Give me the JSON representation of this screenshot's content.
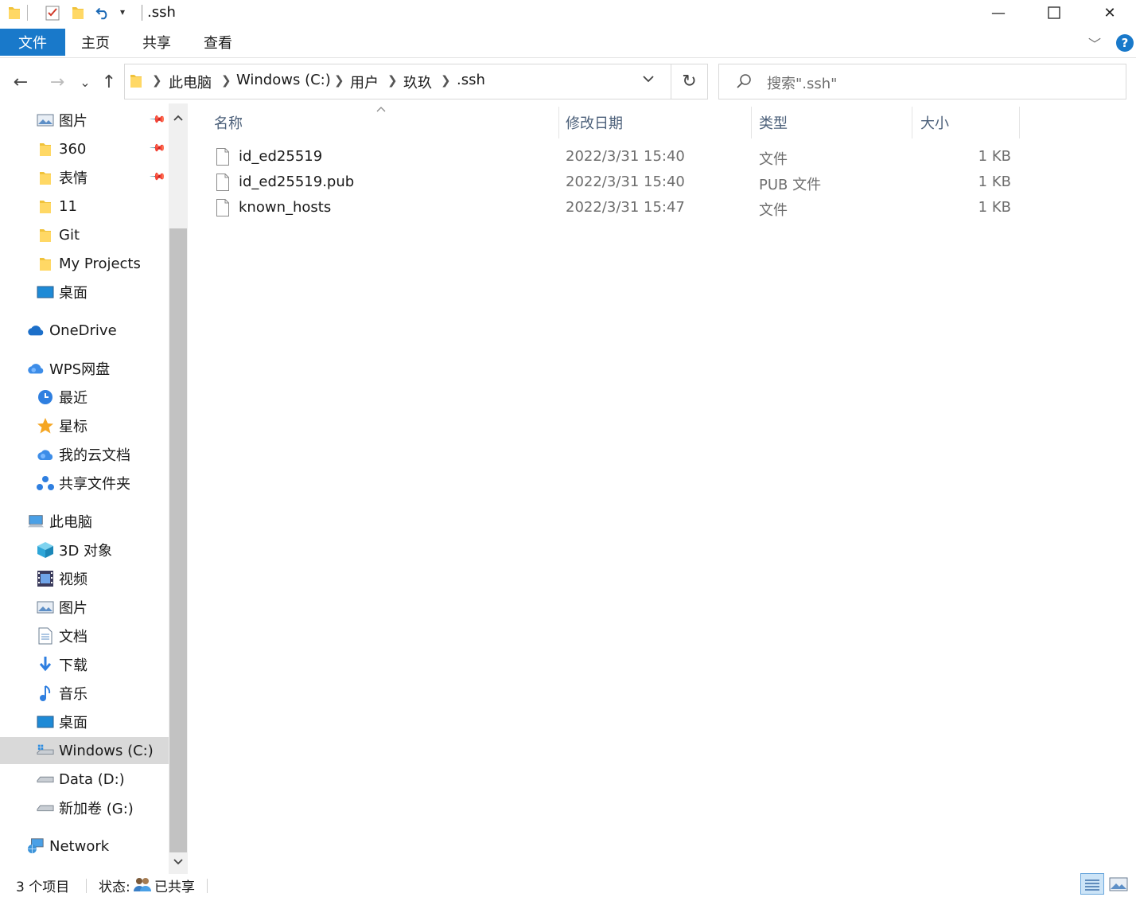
{
  "window": {
    "title": ".ssh",
    "minimize_label": "—",
    "maximize_label": "☐",
    "close_label": "✕"
  },
  "ribbon": {
    "file_tab": "文件",
    "tabs": [
      "主页",
      "共享",
      "查看"
    ],
    "expand_label": "﹀",
    "help_label": "?"
  },
  "nav": {
    "back_label": "←",
    "forward_label": "→",
    "recent_label": "⌄",
    "up_label": "↑",
    "breadcrumb": [
      "此电脑",
      "Windows (C:)",
      "用户",
      "玖玖",
      ".ssh"
    ],
    "refresh_label": "↻",
    "search_placeholder": "搜索\".ssh\""
  },
  "sidebar": {
    "quick_access": [
      {
        "label": "图片",
        "icon": "pictures-icon",
        "pinned": true
      },
      {
        "label": "360",
        "icon": "folder-icon",
        "pinned": true
      },
      {
        "label": "表情",
        "icon": "folder-icon",
        "pinned": true
      },
      {
        "label": "11",
        "icon": "folder-icon",
        "pinned": false
      },
      {
        "label": "Git",
        "icon": "folder-icon",
        "pinned": false
      },
      {
        "label": "My Projects",
        "icon": "folder-icon",
        "pinned": false
      },
      {
        "label": "桌面",
        "icon": "desktop-icon",
        "pinned": false
      }
    ],
    "onedrive": "OneDrive",
    "wps": "WPS网盘",
    "wps_items": [
      {
        "label": "最近",
        "icon": "clock-icon"
      },
      {
        "label": "星标",
        "icon": "star-icon"
      },
      {
        "label": "我的云文档",
        "icon": "cloud-icon"
      },
      {
        "label": "共享文件夹",
        "icon": "share-icon"
      }
    ],
    "this_pc": "此电脑",
    "pc_items": [
      {
        "label": "3D 对象",
        "icon": "cube-icon"
      },
      {
        "label": "视频",
        "icon": "video-icon"
      },
      {
        "label": "图片",
        "icon": "pictures-icon"
      },
      {
        "label": "文档",
        "icon": "document-icon"
      },
      {
        "label": "下载",
        "icon": "download-icon"
      },
      {
        "label": "音乐",
        "icon": "music-icon"
      },
      {
        "label": "桌面",
        "icon": "desktop-icon"
      },
      {
        "label": "Windows (C:)",
        "icon": "windows-drive-icon",
        "selected": true
      },
      {
        "label": "Data (D:)",
        "icon": "drive-icon"
      },
      {
        "label": "新加卷 (G:)",
        "icon": "drive-icon"
      }
    ],
    "network": "Network"
  },
  "columns": {
    "name": "名称",
    "date": "修改日期",
    "type": "类型",
    "size": "大小"
  },
  "files": [
    {
      "name": "id_ed25519",
      "date": "2022/3/31 15:40",
      "type": "文件",
      "size": "1 KB"
    },
    {
      "name": "id_ed25519.pub",
      "date": "2022/3/31 15:40",
      "type": "PUB 文件",
      "size": "1 KB"
    },
    {
      "name": "known_hosts",
      "date": "2022/3/31 15:47",
      "type": "文件",
      "size": "1 KB"
    }
  ],
  "status": {
    "item_count": "3 个项目",
    "state_label": "状态:",
    "state_value": "已共享"
  },
  "colors": {
    "accent": "#1979ca",
    "header_text": "#4c607a",
    "selected_bg": "#d9d9d9"
  }
}
